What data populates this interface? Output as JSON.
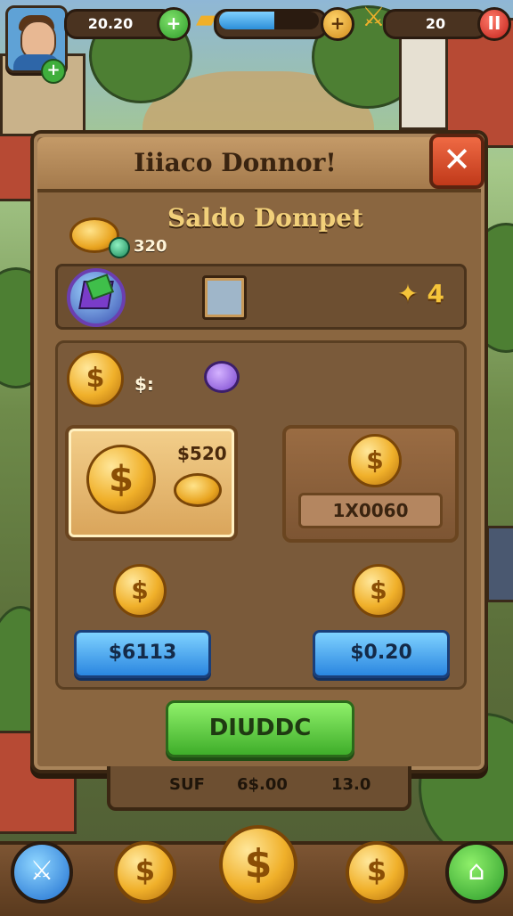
{
  "hud": {
    "coins_value": "20.20",
    "add_label": "+",
    "energy_fill": 0.55,
    "energy_plus": "+",
    "gems_value": "20",
    "pause_label": "II",
    "avatar_add": "+"
  },
  "panel": {
    "title": "Iiiaco Donnor!",
    "close_label": "✕",
    "subtitle": "Saldo Dompet",
    "balance_value": "320",
    "stars_value": "4",
    "dollar_label": "$:",
    "offer_gold_price": "$520",
    "offer_brown_amount": "1X0060",
    "buy_left_label": "$6113",
    "buy_right_label": "$0.20",
    "confirm_label": "DIUDDC",
    "coin_symbol": "$"
  },
  "tab_strip": {
    "left": "SUF",
    "middle": "6$.00",
    "right": "13.0"
  },
  "bottom_nav": {
    "coin_symbol": "$"
  },
  "colors": {
    "panel_brown": "#8a6640",
    "gold": "#f0b02a",
    "blue_button": "#2a86e0",
    "green_button": "#3fae2a",
    "close_red": "#c0391a"
  },
  "icons": [
    "avatar",
    "plus-icon",
    "gold-bar-icon",
    "energy-bar",
    "gem-icon",
    "pause-icon",
    "close-icon",
    "coin-icon",
    "badge-icon",
    "portrait-icon",
    "star-icon",
    "purple-coin-icon",
    "sword-icon",
    "shop-icon"
  ]
}
